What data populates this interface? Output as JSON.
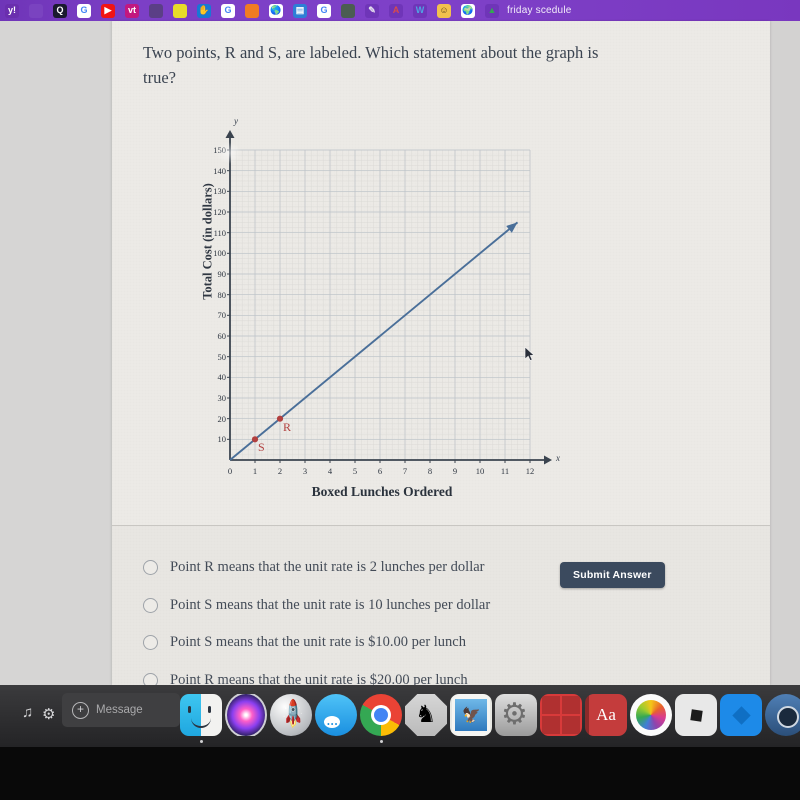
{
  "browser": {
    "active_tab_title": "friday scedule",
    "tab_bar_color": "#7c3fc6",
    "favicons": [
      {
        "name": "yahoo-favicon",
        "glyph": "y!",
        "bg": "#6a2fae",
        "fg": "#ffffff"
      },
      {
        "name": "blank-favicon",
        "glyph": "",
        "bg": "#7a43c0",
        "fg": "#ffffff"
      },
      {
        "name": "quizlet-favicon",
        "glyph": "Q",
        "bg": "#1a1a2e",
        "fg": "#ffffff"
      },
      {
        "name": "google-favicon",
        "glyph": "G",
        "bg": "#ffffff",
        "fg": "#4285f4"
      },
      {
        "name": "youtube-favicon",
        "glyph": "▶",
        "bg": "#f01414",
        "fg": "#ffffff"
      },
      {
        "name": "vt-favicon",
        "glyph": "vt",
        "bg": "#c2187f",
        "fg": "#ffffff"
      },
      {
        "name": "dark-circle-favicon",
        "glyph": "",
        "bg": "#5b3f86",
        "fg": "#ffffff"
      },
      {
        "name": "colorful-squares-favicon",
        "glyph": "",
        "bg": "#e8dd2a",
        "fg": "#ffffff"
      },
      {
        "name": "hand-favicon",
        "glyph": "✋",
        "bg": "#1878d4",
        "fg": "#ffffff"
      },
      {
        "name": "google-favicon-2",
        "glyph": "G",
        "bg": "#ffffff",
        "fg": "#4285f4"
      },
      {
        "name": "flame-favicon",
        "glyph": "",
        "bg": "#f07c22",
        "fg": "#ffffff"
      },
      {
        "name": "globe-favicon",
        "glyph": "🌎",
        "bg": "#ffffff",
        "fg": "#2a8f5a"
      },
      {
        "name": "grid-favicon",
        "glyph": "▤",
        "bg": "#2d7fd6",
        "fg": "#ffffff"
      },
      {
        "name": "google-favicon-3",
        "glyph": "G",
        "bg": "#ffffff",
        "fg": "#4285f4"
      },
      {
        "name": "swirl-favicon",
        "glyph": "",
        "bg": "#4b5d52",
        "fg": "#ffffff"
      },
      {
        "name": "pencil-favicon",
        "glyph": "✎",
        "bg": "#6f35b8",
        "fg": "#e6e0ee"
      },
      {
        "name": "red-a-favicon",
        "glyph": "A",
        "bg": "#6f35b8",
        "fg": "#d94b4b"
      },
      {
        "name": "wikipedia-favicon",
        "glyph": "W",
        "bg": "#6f35b8",
        "fg": "#4fa3e3"
      },
      {
        "name": "smiley-favicon",
        "glyph": "☺",
        "bg": "#f2c14e",
        "fg": "#5a4318"
      },
      {
        "name": "globe-favicon-2",
        "glyph": "🌍",
        "bg": "#ffffff",
        "fg": "#2a8f5a"
      },
      {
        "name": "google-drive-favicon",
        "glyph": "▲",
        "bg": "#6f35b8",
        "fg": "#34a853"
      }
    ]
  },
  "question": {
    "text": "Two points, R and S, are labeled. Which statement about the graph is true?"
  },
  "chart_data": {
    "type": "line",
    "title": "",
    "xlabel": "Boxed Lunches Ordered",
    "ylabel": "Total Cost (in dollars)",
    "x_axis_letter": "x",
    "y_axis_letter": "y",
    "xlim": [
      0,
      12
    ],
    "ylim": [
      0,
      150
    ],
    "x_ticks": [
      "0",
      "1",
      "2",
      "3",
      "4",
      "5",
      "6",
      "7",
      "8",
      "9",
      "10",
      "11",
      "12"
    ],
    "y_ticks": [
      "10",
      "20",
      "30",
      "40",
      "50",
      "60",
      "70",
      "80",
      "90",
      "100",
      "110",
      "120",
      "130",
      "140",
      "150"
    ],
    "grid": true,
    "line_color": "#4a6f99",
    "point_color": "#b2403f",
    "series": [
      {
        "name": "Total Cost",
        "equation_slope": 10,
        "equation_intercept": 0,
        "x": [
          0,
          11.5
        ],
        "y": [
          0,
          115
        ],
        "arrow_end": true
      }
    ],
    "labeled_points": [
      {
        "label": "S",
        "x": 1,
        "y": 10
      },
      {
        "label": "R",
        "x": 2,
        "y": 20
      }
    ]
  },
  "answers": {
    "options": [
      {
        "id": "opt-1",
        "text": "Point R means that the unit rate is 2 lunches per dollar",
        "selected": false
      },
      {
        "id": "opt-2",
        "text": "Point S means that the unit rate is 10 lunches per dollar",
        "selected": false
      },
      {
        "id": "opt-3",
        "text": "Point S means that the unit rate is $10.00 per lunch",
        "selected": false
      },
      {
        "id": "opt-4",
        "text": "Point R means that the unit rate is $20.00 per lunch",
        "selected": false
      }
    ],
    "submit_label": "Submit Answer",
    "submit_color": "#3b4a5e"
  },
  "dock": {
    "message_placeholder": "Message",
    "left_widgets": [
      {
        "name": "headphones-icon",
        "glyph": "♪"
      },
      {
        "name": "gear-icon",
        "glyph": "⚙"
      }
    ],
    "items": [
      {
        "name": "finder-icon",
        "label": "Finder"
      },
      {
        "name": "siri-icon",
        "label": "Siri"
      },
      {
        "name": "launchpad-icon",
        "label": "Launchpad"
      },
      {
        "name": "messages-icon",
        "label": "Messages"
      },
      {
        "name": "chrome-icon",
        "label": "Google Chrome"
      },
      {
        "name": "chess-icon",
        "label": "Chess"
      },
      {
        "name": "mail-icon",
        "label": "Mail"
      },
      {
        "name": "system-preferences-icon",
        "label": "System Preferences"
      },
      {
        "name": "photo-booth-icon",
        "label": "Photo Booth"
      },
      {
        "name": "dictionary-icon",
        "label": "Dictionary"
      },
      {
        "name": "photos-icon",
        "label": "Photos"
      },
      {
        "name": "roblox-icon",
        "label": "Roblox"
      },
      {
        "name": "blue-diamond-app-icon",
        "label": "App"
      },
      {
        "name": "camera-app-icon",
        "label": "Camera"
      }
    ]
  }
}
